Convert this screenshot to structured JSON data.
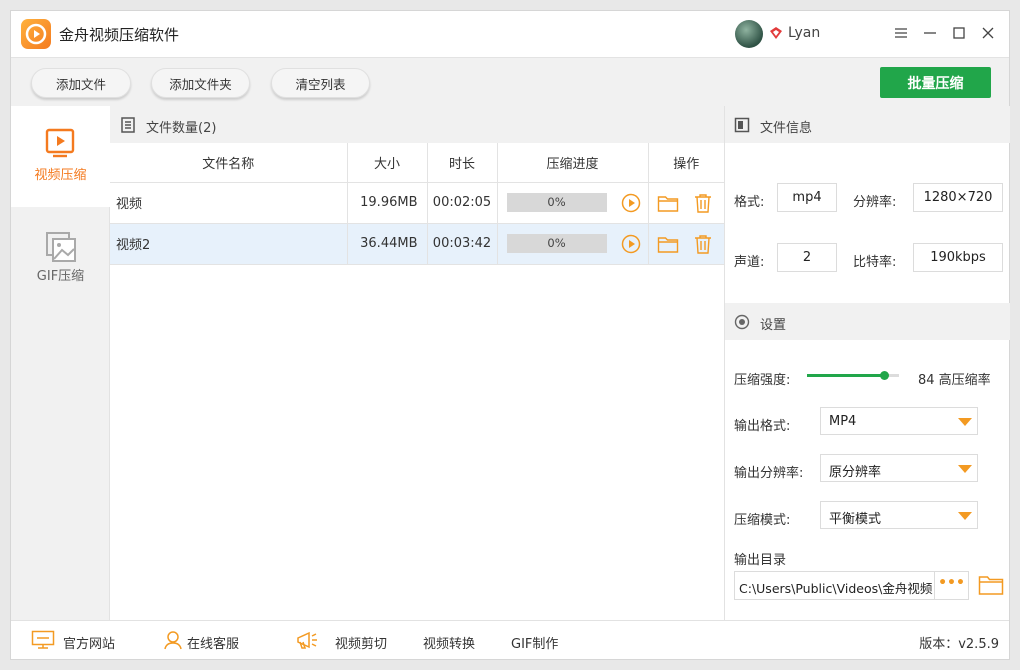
{
  "app": {
    "title": "金舟视频压缩软件"
  },
  "user": {
    "name": "Lyan"
  },
  "toolbar": {
    "add_file": "添加文件",
    "add_folder": "添加文件夹",
    "clear_list": "清空列表",
    "batch_compress": "批量压缩"
  },
  "nav": [
    {
      "label": "视频压缩",
      "icon": "video-play-icon",
      "active": true
    },
    {
      "label": "GIF压缩",
      "icon": "image-icon",
      "active": false
    }
  ],
  "files": {
    "header": "文件数量(2)",
    "columns": [
      "文件名称",
      "大小",
      "时长",
      "压缩进度",
      "操作"
    ],
    "rows": [
      {
        "name": "视频",
        "size": "19.96MB",
        "duration": "00:02:05",
        "progress": "0%",
        "selected": false
      },
      {
        "name": "视频2",
        "size": "36.44MB",
        "duration": "00:03:42",
        "progress": "0%",
        "selected": true
      }
    ]
  },
  "file_info": {
    "header": "文件信息",
    "format_label": "格式:",
    "format_value": "mp4",
    "resolution_label": "分辨率:",
    "resolution_value": "1280×720",
    "channel_label": "声道:",
    "channel_value": "2",
    "bitrate_label": "比特率:",
    "bitrate_value": "190kbps"
  },
  "settings": {
    "header": "设置",
    "strength_label": "压缩强度:",
    "strength_value": 84,
    "strength_text": "84 高压缩率",
    "output_format_label": "输出格式:",
    "output_format_value": "MP4",
    "output_resolution_label": "输出分辨率:",
    "output_resolution_value": "原分辨率",
    "mode_label": "压缩模式:",
    "mode_value": "平衡模式",
    "output_dir_label": "输出目录",
    "output_dir_value": "C:\\Users\\Public\\Videos\\金舟视频压缩软件",
    "more_label": "•••"
  },
  "footer": {
    "website": "官方网站",
    "support": "在线客服",
    "video_cut": "视频剪切",
    "video_convert": "视频转换",
    "gif_make": "GIF制作",
    "version": "版本：v2.5.9"
  },
  "colors": {
    "accent_green": "#21a64a",
    "accent_orange": "#f47a1f",
    "selected_row": "#e7f1fb"
  }
}
